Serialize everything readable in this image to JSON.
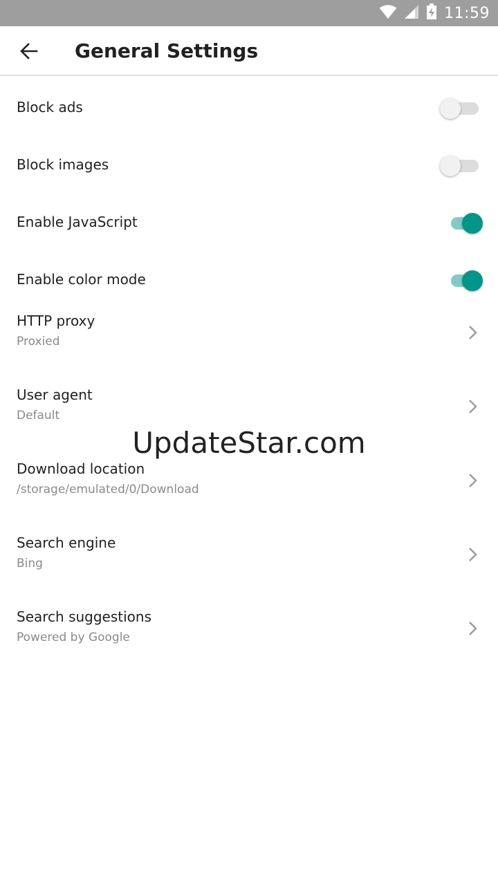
{
  "status_bar": {
    "time": "11:59",
    "icons": [
      "wifi-icon",
      "cell-signal-icon",
      "battery-charging-icon"
    ]
  },
  "app_bar": {
    "back_icon": "arrow-back-icon",
    "title": "General Settings"
  },
  "toggles": [
    {
      "label": "Block ads",
      "enabled": false
    },
    {
      "label": "Block images",
      "enabled": false
    },
    {
      "label": "Enable JavaScript",
      "enabled": true
    },
    {
      "label": "Enable color mode",
      "enabled": true
    }
  ],
  "nav_items": [
    {
      "title": "HTTP proxy",
      "summary": "Proxied"
    },
    {
      "title": "User agent",
      "summary": "Default"
    },
    {
      "title": "Download location",
      "summary": "/storage/emulated/0/Download"
    },
    {
      "title": "Search engine",
      "summary": "Bing"
    },
    {
      "title": "Search suggestions",
      "summary": "Powered by Google"
    }
  ],
  "watermark": "UpdateStar.com",
  "colors": {
    "status_bar": "#9e9e9e",
    "accent": "#009688",
    "accent_track": "#80cbc4",
    "switch_off_track": "#dcdcdc",
    "switch_off_thumb": "#f1f1f1",
    "primary_text": "#212121",
    "secondary_text": "#8a8a8a",
    "chevron": "#9e9e9e"
  }
}
